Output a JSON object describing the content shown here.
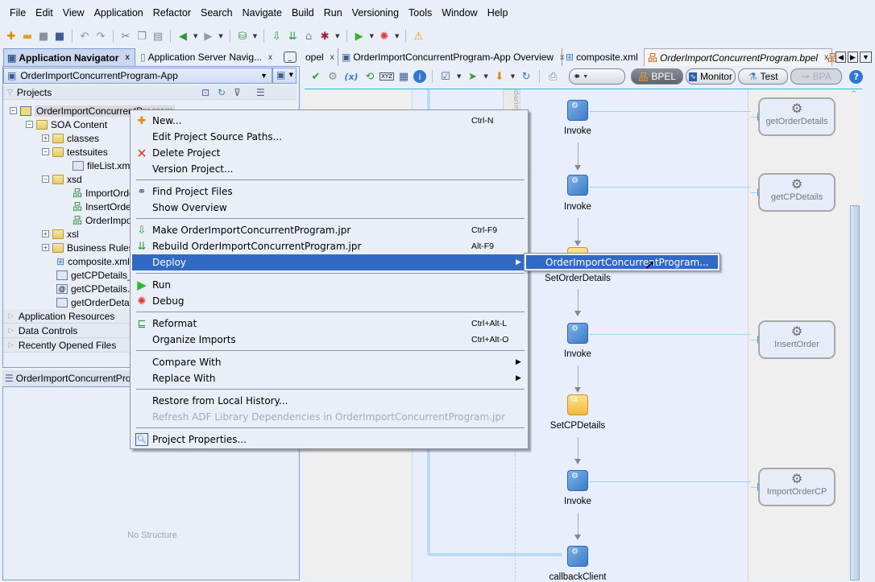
{
  "menubar": {
    "items": [
      {
        "label": "File"
      },
      {
        "label": "Edit"
      },
      {
        "label": "View"
      },
      {
        "label": "Application"
      },
      {
        "label": "Refactor"
      },
      {
        "label": "Search"
      },
      {
        "label": "Navigate"
      },
      {
        "label": "Build"
      },
      {
        "label": "Run"
      },
      {
        "label": "Versioning"
      },
      {
        "label": "Tools"
      },
      {
        "label": "Window"
      },
      {
        "label": "Help"
      }
    ]
  },
  "toolbar": {
    "icons": [
      "new-icon",
      "open-icon",
      "save-icon",
      "save-all-icon",
      "undo-icon",
      "redo-icon",
      "cut-icon",
      "copy-icon",
      "paste-icon",
      "back-icon",
      "forward-icon",
      "sql-worksheet-icon",
      "make-icon",
      "rebuild-icon",
      "clean-icon",
      "profile-icon",
      "run-icon",
      "debug-icon",
      "warning-icon"
    ]
  },
  "left_panel": {
    "tabs": [
      {
        "label": "Application Navigator",
        "active": true
      },
      {
        "label": "Application Server Navig..."
      }
    ],
    "app_selector": "OrderImportConcurrentProgram-App",
    "projects_header": "Projects",
    "tree": [
      {
        "label": "OrderImportConcurrentProgram",
        "level": 0,
        "type": "project",
        "expanded": true,
        "selected": true
      },
      {
        "label": "SOA Content",
        "level": 1,
        "type": "folder",
        "expanded": true
      },
      {
        "label": "classes",
        "level": 2,
        "type": "folder",
        "expanded": false
      },
      {
        "label": "testsuites",
        "level": 2,
        "type": "folder",
        "expanded": true
      },
      {
        "label": "fileList.xml",
        "level": 3,
        "type": "xml"
      },
      {
        "label": "xsd",
        "level": 2,
        "type": "folder",
        "expanded": true
      },
      {
        "label": "ImportOrde",
        "level": 3,
        "type": "schema"
      },
      {
        "label": "InsertOrde",
        "level": 3,
        "type": "schema"
      },
      {
        "label": "OrderImpo",
        "level": 3,
        "type": "schema"
      },
      {
        "label": "xsl",
        "level": 2,
        "type": "folder",
        "expanded": false
      },
      {
        "label": "Business Rules",
        "level": 2,
        "type": "folder",
        "expanded": false
      },
      {
        "label": "composite.xml",
        "level": 2,
        "type": "composite"
      },
      {
        "label": "getCPDetails_f",
        "level": 2,
        "type": "xml"
      },
      {
        "label": "getCPDetails.w",
        "level": 2,
        "type": "wsdl"
      },
      {
        "label": "getOrderDetail",
        "level": 2,
        "type": "xml"
      }
    ],
    "accordions": [
      "Application Resources",
      "Data Controls",
      "Recently Opened Files"
    ],
    "structure_tab": "OrderImportConcurrentProg",
    "structure_empty": "No Structure"
  },
  "editor": {
    "tabs": [
      {
        "label": "opel"
      },
      {
        "label": "OrderImportConcurrentProgram-App Overview"
      },
      {
        "label": "composite.xml"
      },
      {
        "label": "OrderImportConcurrentProgram.bpel",
        "active": true
      }
    ],
    "modes": [
      {
        "label": "BPEL",
        "active": true
      },
      {
        "label": "Monitor"
      },
      {
        "label": "Test"
      },
      {
        "label": "BPA",
        "disabled": true
      }
    ],
    "swimlane_label": "derIm",
    "activities": [
      {
        "label": "Invoke",
        "type": "invoke"
      },
      {
        "label": "Invoke",
        "type": "invoke"
      },
      {
        "label": "SetOrderDetails",
        "type": "assign"
      },
      {
        "label": "Invoke",
        "type": "invoke"
      },
      {
        "label": "SetCPDetails",
        "type": "assign"
      },
      {
        "label": "Invoke",
        "type": "invoke"
      },
      {
        "label": "callbackClient",
        "type": "invoke"
      }
    ],
    "partner_links": [
      "getOrderDetails",
      "getCPDetails",
      "InsertOrder",
      "ImportOrderCP"
    ]
  },
  "context_menu": {
    "items": [
      {
        "label": "New...",
        "shortcut": "Ctrl-N",
        "icon": "new-icon"
      },
      {
        "label": "Edit Project Source Paths..."
      },
      {
        "label": "Delete Project",
        "icon": "delete-icon"
      },
      {
        "label": "Version Project..."
      },
      {
        "separator": true
      },
      {
        "label": "Find Project Files",
        "icon": "binoculars-icon"
      },
      {
        "label": "Show Overview"
      },
      {
        "separator": true
      },
      {
        "label": "Make OrderImportConcurrentProgram.jpr",
        "shortcut": "Ctrl-F9",
        "icon": "make-icon"
      },
      {
        "label": "Rebuild OrderImportConcurrentProgram.jpr",
        "shortcut": "Alt-F9",
        "icon": "rebuild-icon"
      },
      {
        "label": "Deploy",
        "submenu": true,
        "highlighted": true
      },
      {
        "separator": true
      },
      {
        "label": "Run",
        "icon": "run-icon"
      },
      {
        "label": "Debug",
        "icon": "debug-icon"
      },
      {
        "separator": true
      },
      {
        "label": "Reformat",
        "shortcut": "Ctrl+Alt-L",
        "icon": "reformat-icon"
      },
      {
        "label": "Organize Imports",
        "shortcut": "Ctrl+Alt-O"
      },
      {
        "separator": true
      },
      {
        "label": "Compare With",
        "submenu": true
      },
      {
        "label": "Replace With",
        "submenu": true
      },
      {
        "separator": true
      },
      {
        "label": "Restore from Local History..."
      },
      {
        "label": "Refresh ADF Library Dependencies in OrderImportConcurrentProgram.jpr",
        "disabled": true
      },
      {
        "separator": true
      },
      {
        "label": "Project Properties...",
        "icon": "properties-icon"
      }
    ],
    "submenu": {
      "label": "OrderImportConcurrentProgram..."
    }
  },
  "colors": {
    "highlight": "#316ac5",
    "accent_border": "#2bbce0",
    "link": "#3f9be6"
  }
}
